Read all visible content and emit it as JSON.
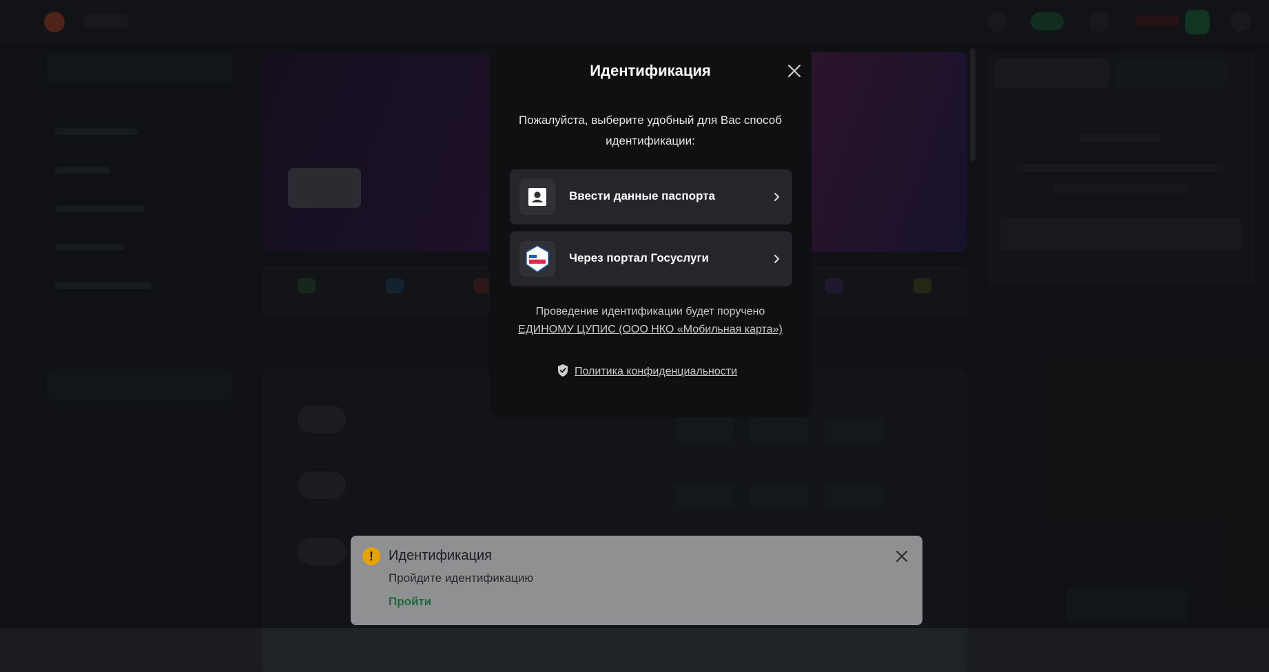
{
  "modal": {
    "title": "Идентификация",
    "description": "Пожалуйста, выберите удобный для Вас способ идентификации:",
    "options": [
      {
        "label": "Ввести данные паспорта",
        "icon": "id-card-icon"
      },
      {
        "label": "Через портал Госуслуги",
        "icon": "gosuslugi-logo-icon"
      }
    ],
    "note": "Проведение идентификации будет поручено",
    "note_link": "ЕДИНОМУ ЦУПИС (ООО НКО «Мобильная карта»)",
    "policy_link": "Политика конфиденциальности"
  },
  "toast": {
    "title": "Идентификация",
    "message": "Пройдите идентификацию",
    "action": "Пройти"
  },
  "colors": {
    "modal_bg": "#0f1012",
    "option_bg": "#24262a",
    "toast_bg": "#8e9092",
    "warning": "#e6a300",
    "action_green": "#1f6a3a"
  }
}
